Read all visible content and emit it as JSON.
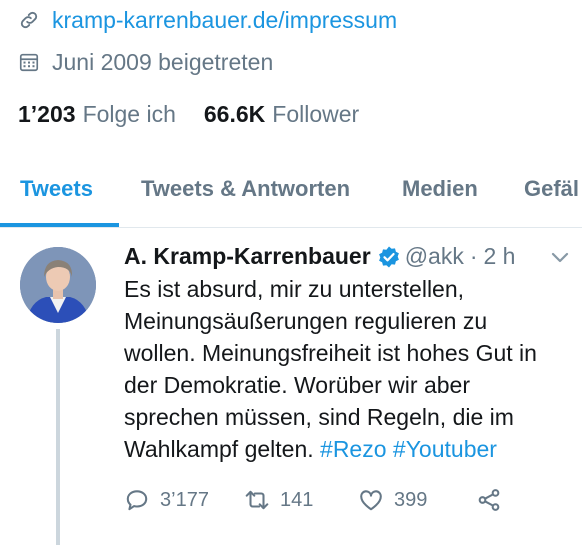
{
  "profile": {
    "website": "kramp-karrenbauer.de/impressum",
    "joined": "Juni 2009 beigetreten",
    "following_count": "1’203",
    "following_label": "Folge ich",
    "followers_count": "66.6K",
    "followers_label": "Follower"
  },
  "tabs": [
    {
      "label": "Tweets",
      "active": true
    },
    {
      "label": "Tweets & Antworten",
      "active": false
    },
    {
      "label": "Medien",
      "active": false
    },
    {
      "label": "Gefäl",
      "active": false
    }
  ],
  "tweet": {
    "name": "A. Kramp-Karrenbauer",
    "handle": "@akk",
    "dot": "·",
    "time": "2 h",
    "text_lines": [
      "Es ist absurd, mir zu unterstellen,",
      "Meinungsäußerungen regulieren zu",
      "wollen. Meinungsfreiheit ist hohes Gut in",
      "der Demokratie. Worüber wir aber",
      "sprechen müssen, sind Regeln, die im",
      "Wahlkampf gelten. "
    ],
    "hashtags": [
      "#Rezo",
      "#Youtuber"
    ],
    "replies": "3’177",
    "retweets": "141",
    "likes": "399"
  },
  "colors": {
    "accent": "#1b95e0",
    "muted": "#657786",
    "text": "#14171a"
  },
  "icons": [
    "link-icon",
    "calendar-icon",
    "verified-badge-icon",
    "chevron-down-icon",
    "reply-icon",
    "retweet-icon",
    "like-icon",
    "share-icon"
  ]
}
